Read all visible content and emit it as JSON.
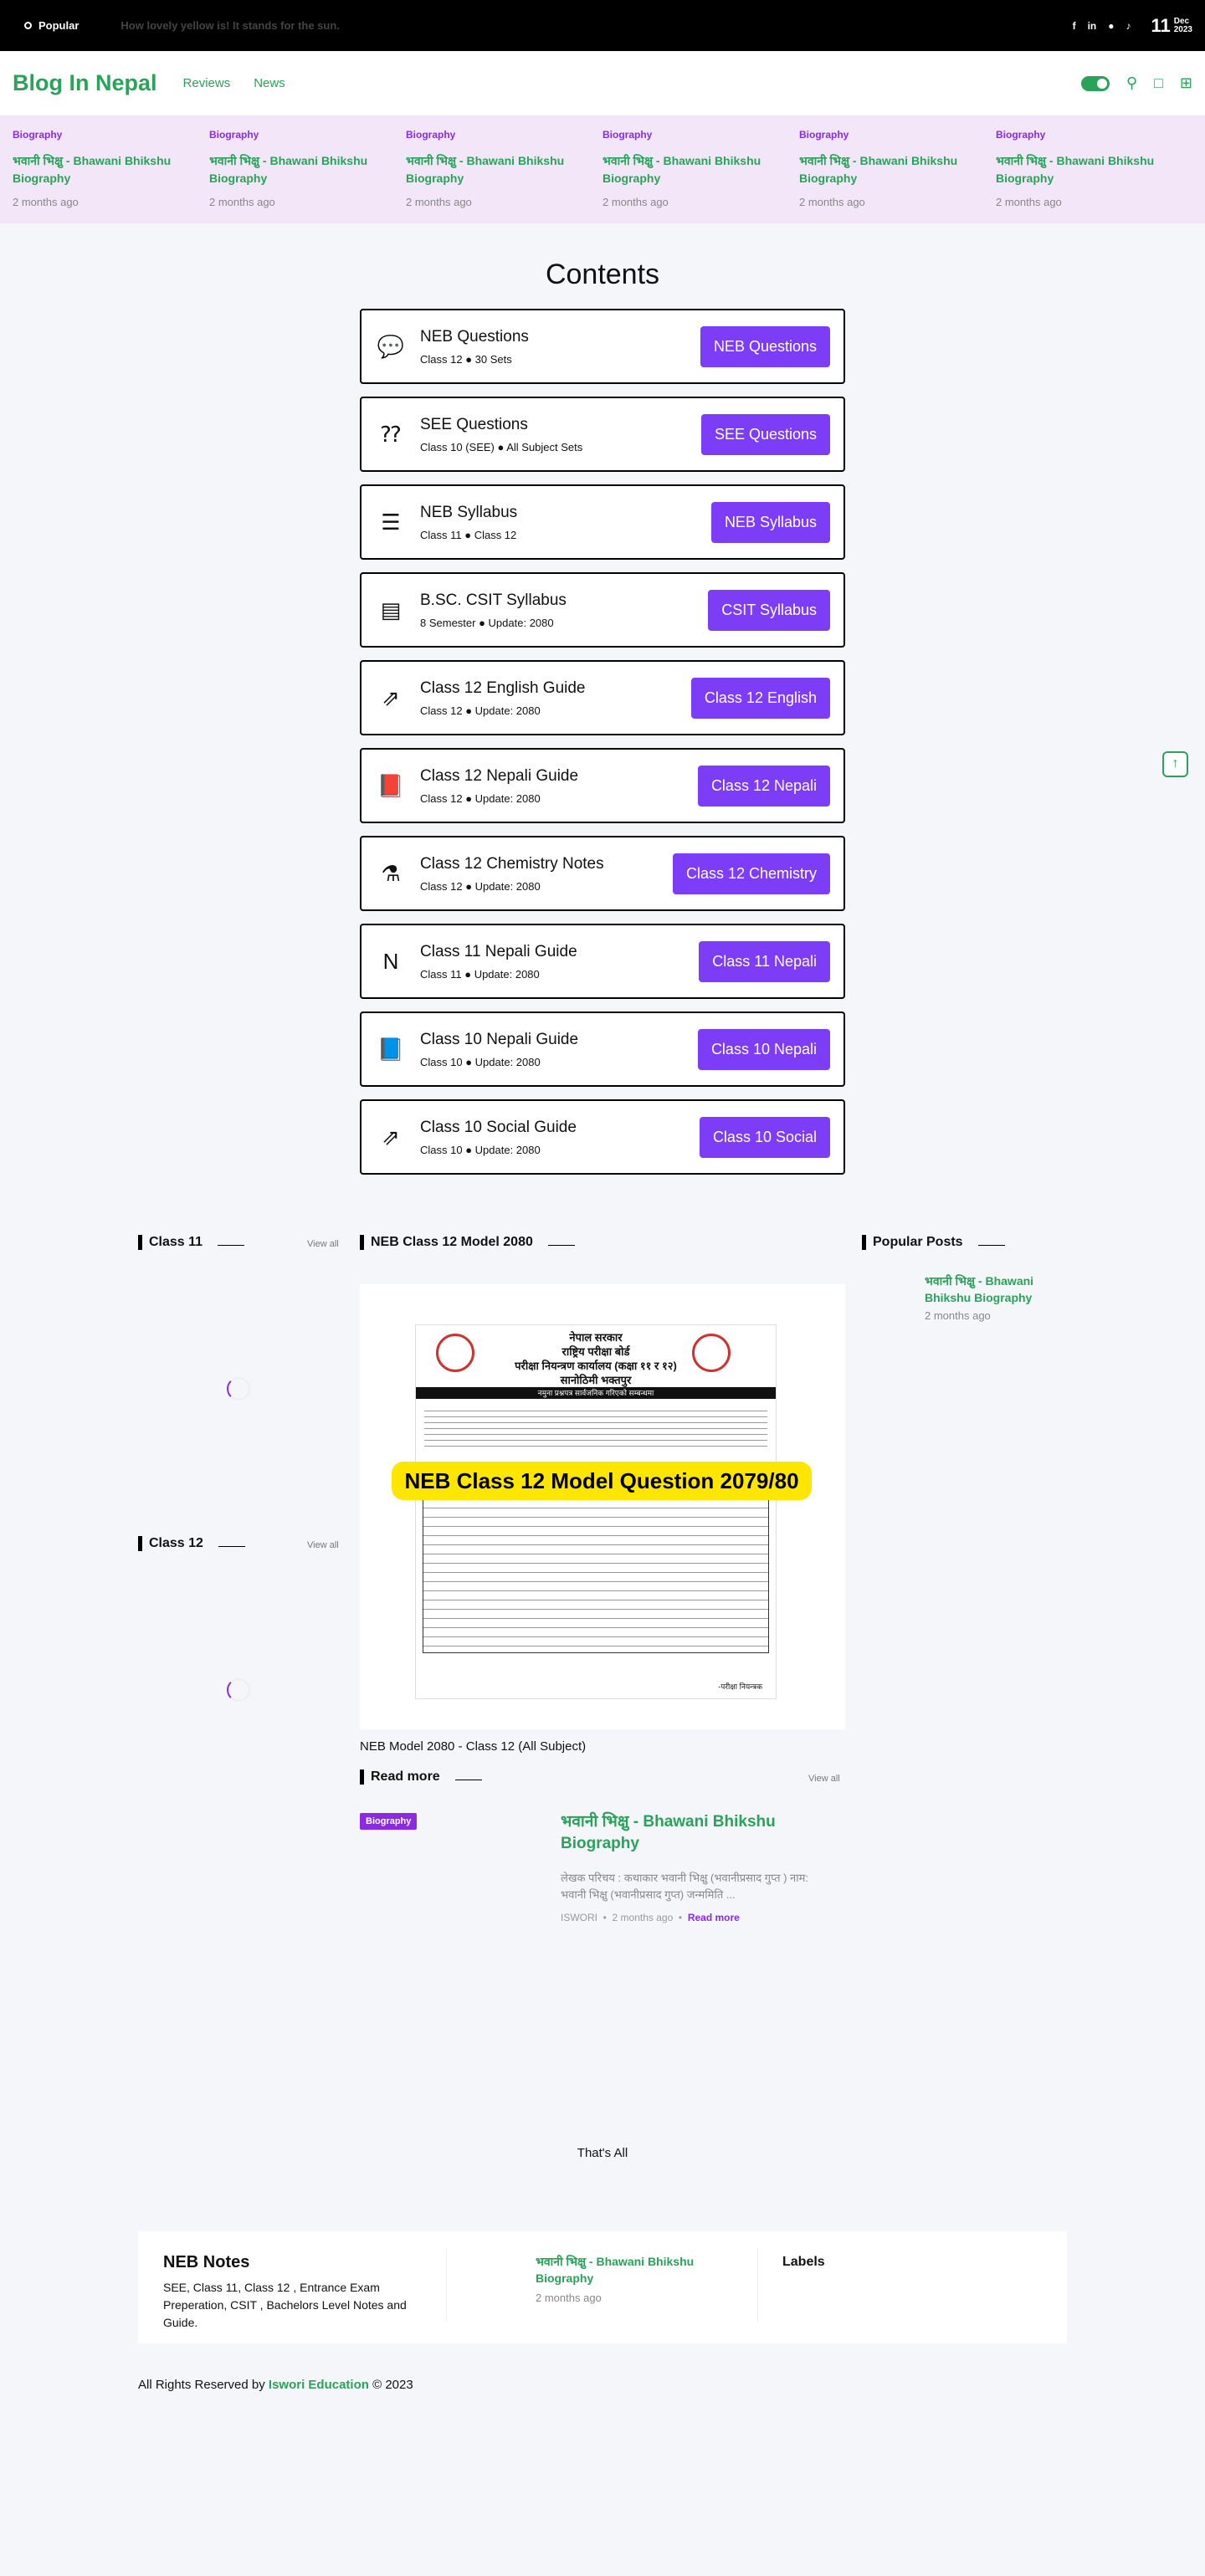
{
  "topbar": {
    "popular_label": "Popular",
    "ticker_text": "How lovely yellow is! It stands for the sun.",
    "date_day": "11",
    "date_month": "Dec",
    "date_year": "2023"
  },
  "header": {
    "logo": "Blog In Nepal",
    "nav": [
      "Reviews",
      "News"
    ]
  },
  "strip": [
    {
      "cat": "Biography",
      "title": "भवानी भिक्षु - Bhawani Bhikshu Biography",
      "ago": "2 months ago"
    },
    {
      "cat": "Biography",
      "title": "भवानी भिक्षु - Bhawani Bhikshu Biography",
      "ago": "2 months ago"
    },
    {
      "cat": "Biography",
      "title": "भवानी भिक्षु - Bhawani Bhikshu Biography",
      "ago": "2 months ago"
    },
    {
      "cat": "Biography",
      "title": "भवानी भिक्षु - Bhawani Bhikshu Biography",
      "ago": "2 months ago"
    },
    {
      "cat": "Biography",
      "title": "भवानी भिक्षु - Bhawani Bhikshu Biography",
      "ago": "2 months ago"
    },
    {
      "cat": "Biography",
      "title": "भवानी भिक्षु - Bhawani Bhikshu Biography",
      "ago": "2 months ago"
    }
  ],
  "contents": {
    "title": "Contents",
    "cards": [
      {
        "title": "NEB Questions",
        "sub": "Class 12 ● 30 Sets",
        "button": "NEB Questions",
        "icon": "chat-bubbles-icon"
      },
      {
        "title": "SEE Questions",
        "sub": "Class 10 (SEE) ● All Subject Sets",
        "button": "SEE Questions",
        "icon": "question-people-icon"
      },
      {
        "title": "NEB Syllabus",
        "sub": "Class 11 ● Class 12",
        "button": "NEB Syllabus",
        "icon": "notebook-icon"
      },
      {
        "title": "B.SC. CSIT Syllabus",
        "sub": "8 Semester ● Update: 2080",
        "button": "CSIT Syllabus",
        "icon": "document-icon"
      },
      {
        "title": "Class 12 English Guide",
        "sub": "Class 12 ● Update: 2080",
        "button": "Class 12 English",
        "icon": "open-book-icon"
      },
      {
        "title": "Class 12 Nepali Guide",
        "sub": "Class 12 ● Update: 2080",
        "button": "Class 12 Nepali",
        "icon": "red-book-icon"
      },
      {
        "title": "Class 12 Chemistry Notes",
        "sub": "Class 12 ● Update: 2080",
        "button": "Class 12 Chemistry",
        "icon": "chemistry-icon"
      },
      {
        "title": "Class 11 Nepali Guide",
        "sub": "Class 11 ● Update: 2080",
        "button": "Class 11 Nepali",
        "icon": "letter-n-icon"
      },
      {
        "title": "Class 10 Nepali Guide",
        "sub": "Class 10 ● Update: 2080",
        "button": "Class 10 Nepali",
        "icon": "blue-notebook-icon"
      },
      {
        "title": "Class 10 Social Guide",
        "sub": "Class 10 ● Update: 2080",
        "button": "Class 10 Social",
        "icon": "open-book-icon"
      }
    ]
  },
  "sidebar": {
    "class11": "Class 11",
    "class12": "Class 12",
    "view_all": "View all"
  },
  "model": {
    "heading": "NEB Class 12 Model 2080",
    "doc_header": "नेपाल सरकार\nराष्ट्रिय परीक्षा बोर्ड\nपरीक्षा नियन्त्रण कार्यालय (कक्षा ११ र १२)\nसानोठिमी भक्तपुर",
    "doc_band": "नमुना प्रश्नपत्र सार्वजनिक गरिएको सम्बन्धमा",
    "doc_sig": "-परीक्षा नियन्त्रक",
    "banner": "NEB Class 12 Model Question 2079/80",
    "caption": "NEB Model 2080 - Class 12 (All Subject)"
  },
  "read_more": {
    "heading": "Read more",
    "view_all": "View all",
    "tag": "Biography",
    "title": "भवानी भिक्षु - Bhawani Bhikshu Biography",
    "excerpt": "लेखक परिचय : कथाकार भवानी भिक्षु (भवानीप्रसाद गुप्त ) नाम: भवानी भिक्षु (भवानीप्रसाद गुप्त) जन्ममिति ...",
    "author": "ISWORI",
    "ago": "2 months ago",
    "link": "Read more"
  },
  "popular": {
    "heading": "Popular Posts",
    "title": "भवानी भिक्षु - Bhawani Bhikshu Biography",
    "ago": "2 months ago"
  },
  "thats_all": "That's All",
  "footer": {
    "brand": "NEB Notes",
    "desc": "SEE, Class 11, Class 12 , Entrance Exam Preperation, CSIT , Bachelors Level Notes and Guide.",
    "post_title": "भवानी भिक्षु - Bhawani Bhikshu Biography",
    "post_ago": "2 months ago",
    "labels": "Labels",
    "copy_prefix": "All Rights Reserved by",
    "copy_brand": "Iswori Education",
    "copy_suffix": "© 2023"
  },
  "colors": {
    "accent": "#29a35a",
    "purple": "#7d3cf5",
    "tag": "#8a2be2"
  }
}
